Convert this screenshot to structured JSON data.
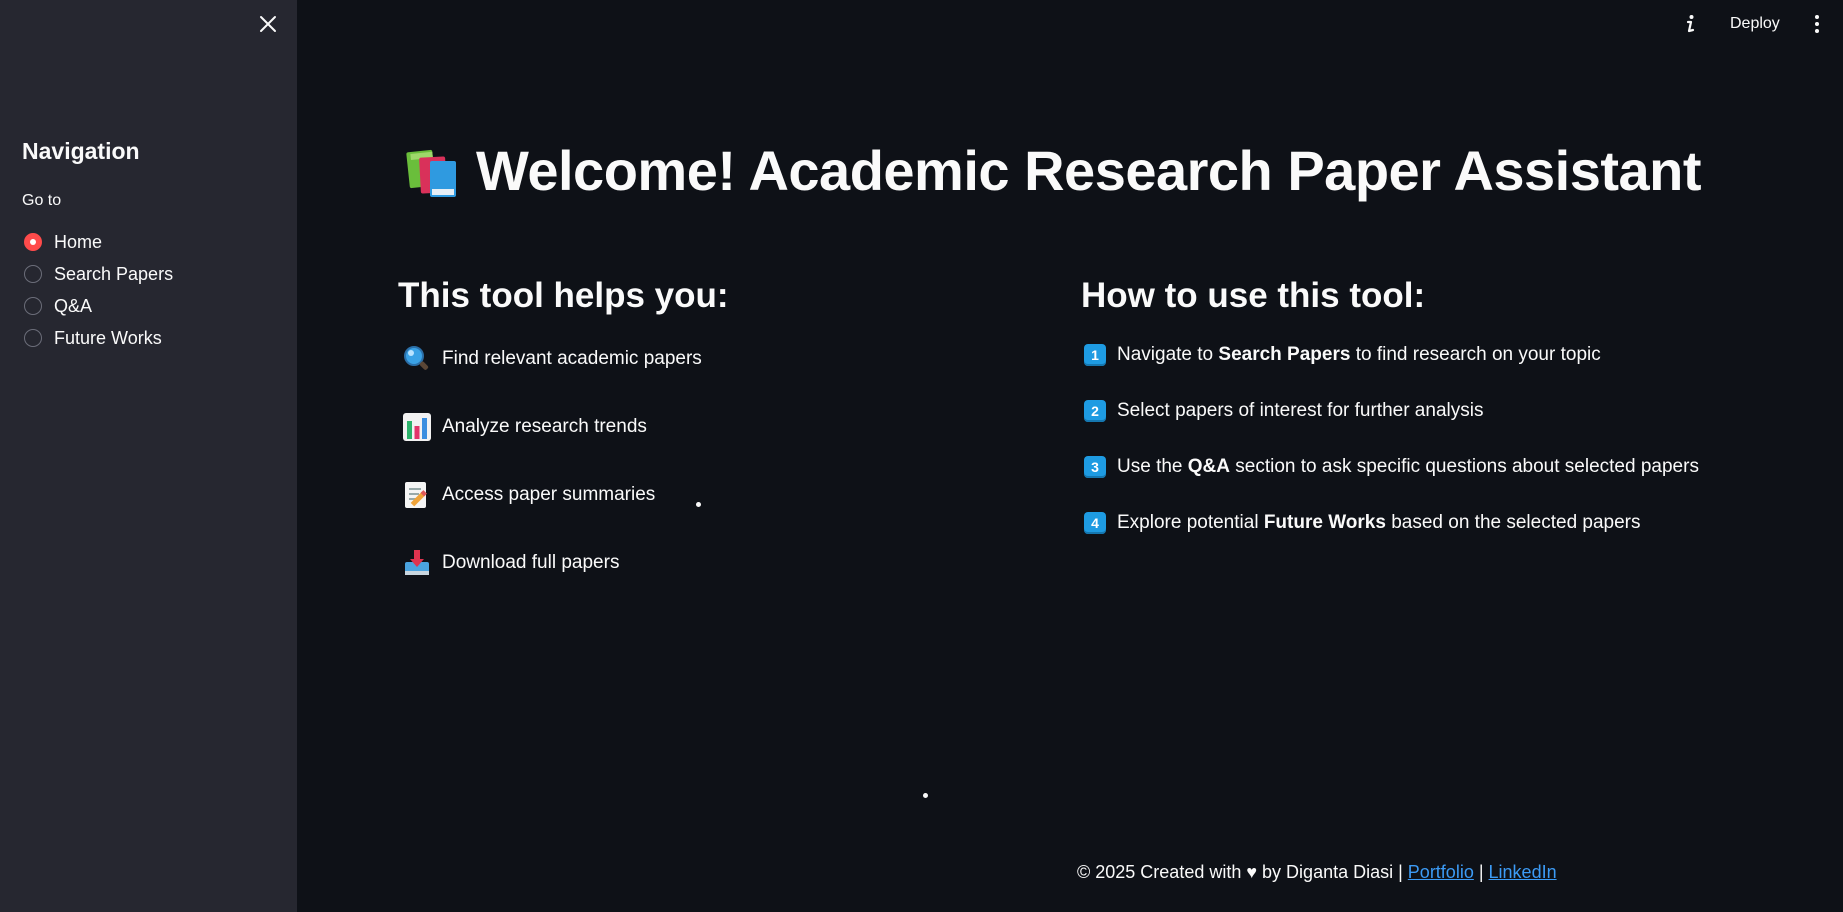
{
  "sidebar": {
    "title": "Navigation",
    "radio_label": "Go to",
    "options": [
      {
        "label": "Home",
        "selected": true
      },
      {
        "label": "Search Papers",
        "selected": false
      },
      {
        "label": "Q&A",
        "selected": false
      },
      {
        "label": "Future Works",
        "selected": false
      }
    ]
  },
  "topbar": {
    "deploy_label": "Deploy"
  },
  "main": {
    "title": "Welcome! Academic Research Paper Assistant",
    "left_heading": "This tool helps you:",
    "features": [
      {
        "icon": "magnifier-icon",
        "text": "Find relevant academic papers"
      },
      {
        "icon": "bar-chart-icon",
        "text": "Analyze research trends"
      },
      {
        "icon": "memo-icon",
        "text": "Access paper summaries"
      },
      {
        "icon": "inbox-download-icon",
        "text": "Download full papers"
      }
    ],
    "right_heading": "How to use this tool:",
    "steps": [
      {
        "num": "1",
        "pre": "Navigate to ",
        "bold": "Search Papers",
        "post": " to find research on your topic"
      },
      {
        "num": "2",
        "pre": "Select papers of interest for further analysis",
        "bold": "",
        "post": ""
      },
      {
        "num": "3",
        "pre": "Use the ",
        "bold": "Q&A",
        "post": " section to ask specific questions about selected papers"
      },
      {
        "num": "4",
        "pre": "Explore potential ",
        "bold": "Future Works",
        "post": " based on the selected papers"
      }
    ]
  },
  "footer": {
    "text": "© 2025 Created with ♥ by Diganta Diasi | ",
    "link1": "Portfolio",
    "separator": " | ",
    "link2": "LinkedIn"
  },
  "colors": {
    "background": "#0e1117",
    "sidebar": "#262730",
    "accent": "#ff4b4b",
    "link": "#3c9bf5"
  }
}
